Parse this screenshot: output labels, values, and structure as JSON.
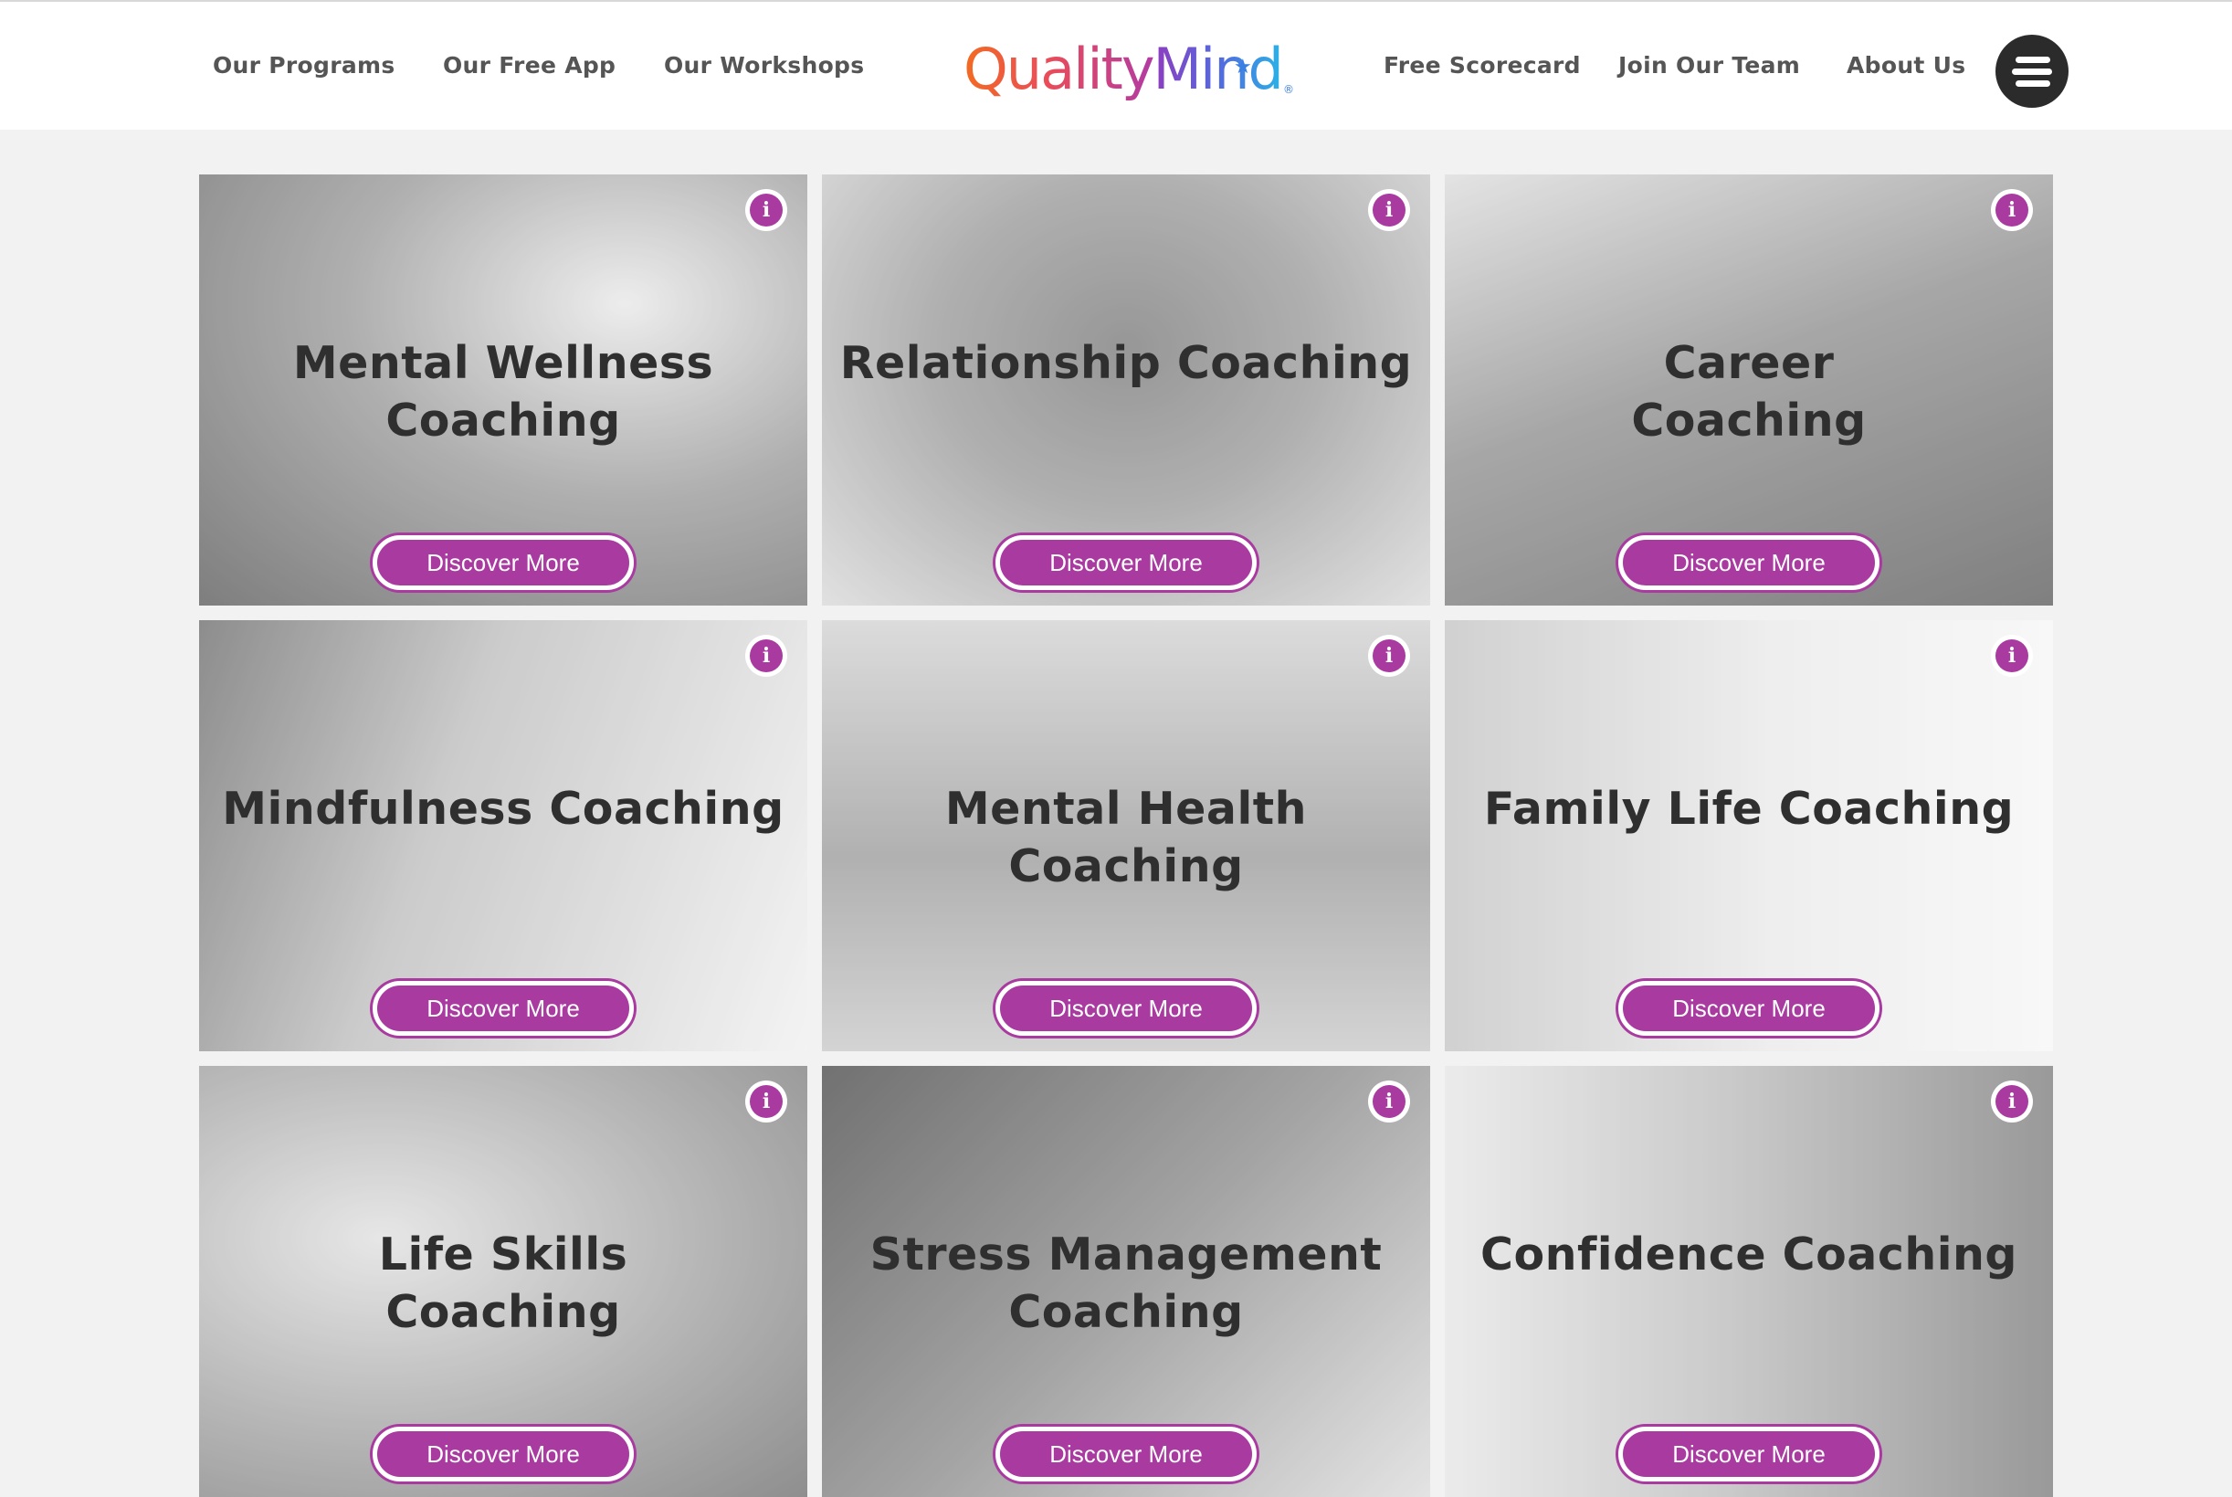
{
  "header": {
    "nav_left": [
      "Our Programs",
      "Our Free App",
      "Our Workshops"
    ],
    "logo": {
      "part1": "Quality",
      "part2": "Mind",
      "star": "★",
      "registered": "®"
    },
    "nav_right": [
      "Free Scorecard",
      "Join Our Team",
      "About Us"
    ],
    "menu_icon": "hamburger-menu-icon"
  },
  "colors": {
    "accent": "#a83aa0",
    "page_bg": "#f2f2f2"
  },
  "cards": [
    {
      "title": "Mental Wellness Coaching",
      "button": "Discover More",
      "info_icon": "i"
    },
    {
      "title": "Relationship Coaching",
      "button": "Discover More",
      "info_icon": "i"
    },
    {
      "title": "Career Coaching",
      "button": "Discover More",
      "info_icon": "i"
    },
    {
      "title": "Mindfulness Coaching",
      "button": "Discover More",
      "info_icon": "i"
    },
    {
      "title": "Mental Health Coaching",
      "button": "Discover More",
      "info_icon": "i"
    },
    {
      "title": "Family Life Coaching",
      "button": "Discover More",
      "info_icon": "i"
    },
    {
      "title": "Life Skills Coaching",
      "button": "Discover More",
      "info_icon": "i"
    },
    {
      "title": "Stress Management Coaching",
      "button": "Discover More",
      "info_icon": "i"
    },
    {
      "title": "Confidence Coaching",
      "button": "Discover More",
      "info_icon": "i"
    }
  ]
}
